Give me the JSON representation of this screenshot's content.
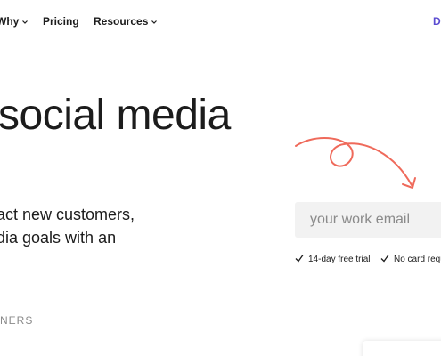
{
  "nav": {
    "items": [
      {
        "label": "Why",
        "has_dropdown": true
      },
      {
        "label": "Pricing",
        "has_dropdown": false
      },
      {
        "label": "Resources",
        "has_dropdown": true
      }
    ],
    "right_partial": "D"
  },
  "hero": {
    "headline": "social media",
    "sub_line1": "act new customers,",
    "sub_line2": "dia goals with an"
  },
  "signup": {
    "email_placeholder": "your work email",
    "checks": [
      {
        "label": "14-day free trial"
      },
      {
        "label": "No card requ"
      }
    ]
  },
  "partners_label": "NERS",
  "colors": {
    "accent": "#5a4bd1",
    "arrow": "#ef6a5b",
    "input_bg": "#f2f2f2",
    "muted_text": "#8a8a8a"
  }
}
